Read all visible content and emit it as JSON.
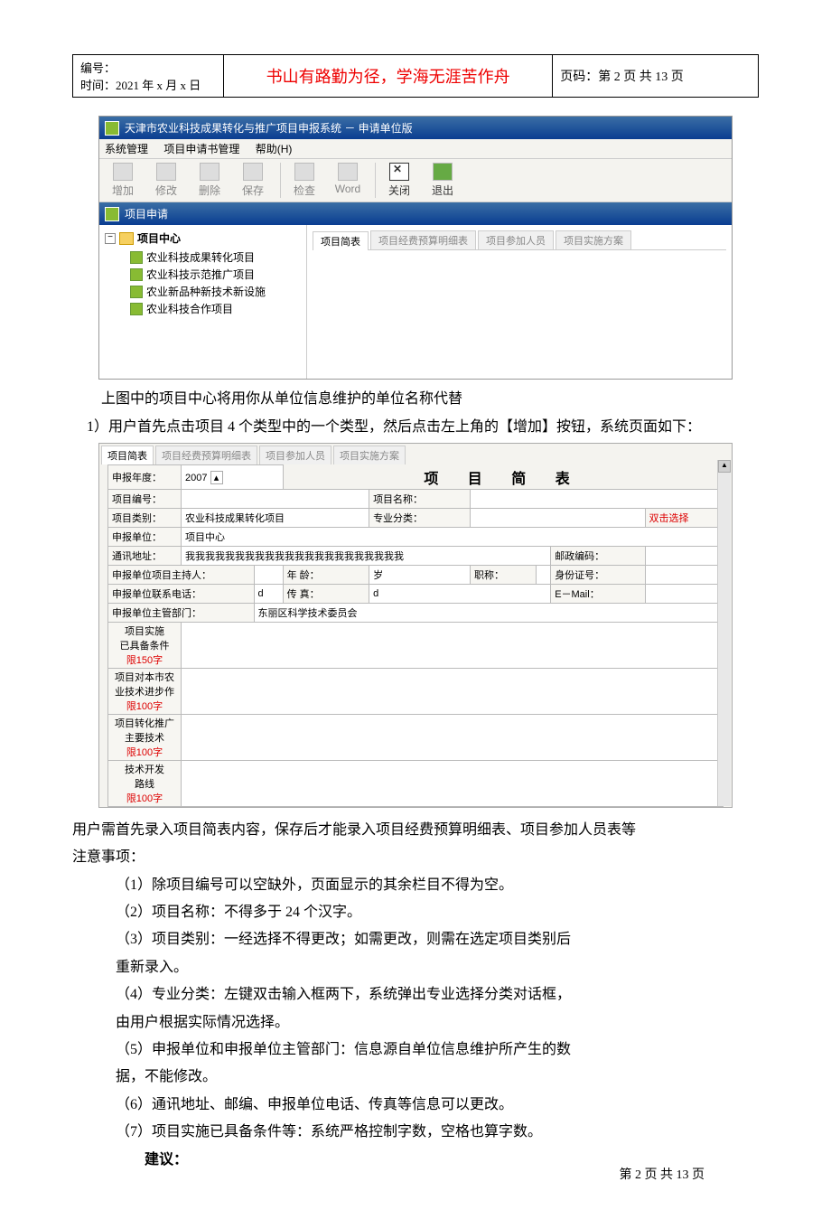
{
  "header": {
    "id_label": "编号：",
    "time_label": "时间：2021 年 x 月 x 日",
    "motto": "书山有路勤为径，学海无涯苦作舟",
    "page_label": "页码：第 2 页  共 13 页"
  },
  "shot1": {
    "title": "天津市农业科技成果转化与推广项目申报系统 － 申请单位版",
    "menus": [
      "系统管理",
      "项目申请书管理",
      "帮助(H)"
    ],
    "toolbar": [
      {
        "label": "增加",
        "active": false
      },
      {
        "label": "修改",
        "active": false
      },
      {
        "label": "删除",
        "active": false
      },
      {
        "label": "保存",
        "active": false
      },
      {
        "label": "检查",
        "active": false
      },
      {
        "label": "Word",
        "active": false
      },
      {
        "label": "关闭",
        "active": true,
        "kind": "close"
      },
      {
        "label": "退出",
        "active": true,
        "kind": "exit"
      }
    ],
    "subtitle": "项目申请",
    "tree": {
      "root": "项目中心",
      "children": [
        "农业科技成果转化项目",
        "农业科技示范推广项目",
        "农业新品种新技术新设施",
        "农业科技合作项目"
      ]
    },
    "tabs": [
      "项目简表",
      "项目经费预算明细表",
      "项目参加人员",
      "项目实施方案"
    ]
  },
  "caption1": "上图中的项目中心将用你从单位信息维护的单位名称代替",
  "caption2": "1）用户首先点击项目 4 个类型中的一个类型，然后点击左上角的【增加】按钮，系统页面如下：",
  "shot2": {
    "tabs": [
      "项目简表",
      "项目经费预算明细表",
      "项目参加人员",
      "项目实施方案"
    ],
    "title": "项 目 简 表",
    "rows": {
      "year_label": "申报年度：",
      "year_value": "2007",
      "id_label": "项目编号：",
      "name_label": "项目名称：",
      "type_label": "项目类别：",
      "type_value": "农业科技成果转化项目",
      "major_label": "专业分类：",
      "dblclick": "双击选择",
      "org_label": "申报单位：",
      "org_value": "项目中心",
      "addr_label": "通讯地址：",
      "addr_value": "我我我我我我我我我我我我我我我我我我我我我我",
      "zip_label": "邮政编码：",
      "leader_label": "申报单位项目主持人：",
      "age_label": "年 龄：",
      "age_val": "岁",
      "title_label": "职称：",
      "idcard_label": "身份证号：",
      "tel_label": "申报单位联系电话：",
      "tel_value": "d",
      "fax_label": "传 真：",
      "fax_value": "d",
      "email_label": "E－Mail：",
      "dept_label": "申报单位主管部门：",
      "dept_value": "东丽区科学技术委员会"
    },
    "bigrows": [
      {
        "l1": "项目实施",
        "l2": "已具备条件",
        "limit": "限150字"
      },
      {
        "l1": "项目对本市农",
        "l2": "业技术进步作",
        "limit": "限100字"
      },
      {
        "l1": "项目转化推广",
        "l2": "主要技术",
        "limit": "限100字"
      },
      {
        "l1": "技术开发",
        "l2": "路线",
        "limit": "限100字"
      }
    ]
  },
  "body": {
    "p1": "用户需首先录入项目简表内容，保存后才能录入项目经费预算明细表、项目参加人员表等",
    "p2": "注意事项：",
    "li1": "（1）除项目编号可以空缺外，页面显示的其余栏目不得为空。",
    "li2": "（2）项目名称：不得多于 24 个汉字。",
    "li3a": "（3）项目类别：一经选择不得更改；如需更改，则需在选定项目类别后",
    "li3b": "重新录入。",
    "li4a": "（4）专业分类：左键双击输入框两下，系统弹出专业选择分类对话框，",
    "li4b": "由用户根据实际情况选择。",
    "li5a": "（5）申报单位和申报单位主管部门：信息源自单位信息维护所产生的数",
    "li5b": "据，不能修改。",
    "li6": "（6）通讯地址、邮编、申报单位电话、传真等信息可以更改。",
    "li7": "（7）项目实施已具备条件等：系统严格控制字数，空格也算字数。",
    "suggest": "建议："
  },
  "footer": "第 2 页 共 13 页"
}
